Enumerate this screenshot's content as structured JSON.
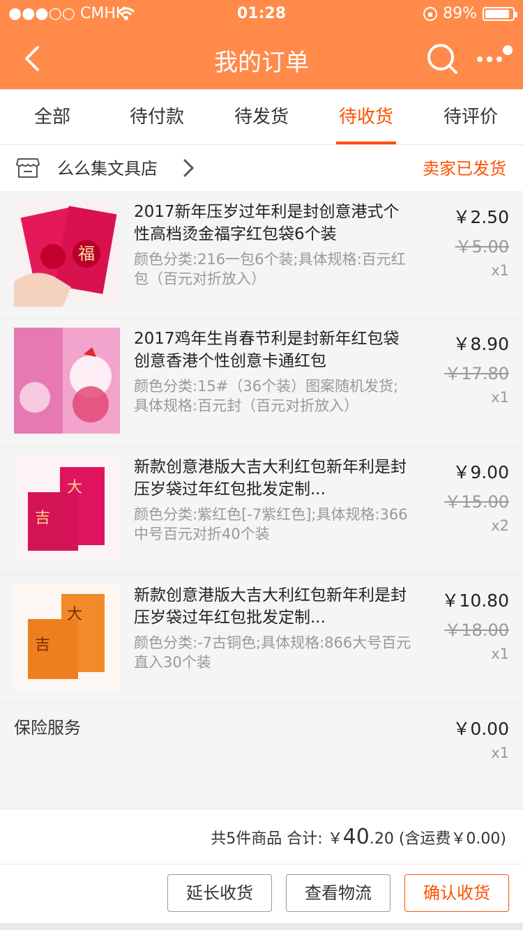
{
  "status_bar": {
    "carrier": "●●●○○ CMHK",
    "time": "01:28",
    "battery": "89%"
  },
  "header": {
    "title": "我的订单"
  },
  "tabs": [
    {
      "label": "全部"
    },
    {
      "label": "待付款"
    },
    {
      "label": "待发货"
    },
    {
      "label": "待收货",
      "active": true
    },
    {
      "label": "待评价"
    }
  ],
  "shop": {
    "name": "么么集文具店",
    "status": "卖家已发货"
  },
  "items": [
    {
      "title": "2017新年压岁过年利是封创意港式个性高档烫金福字红包袋6个装",
      "spec": "颜色分类:216一包6个装;具体规格:百元红包（百元对折放入）",
      "price": "￥2.50",
      "orig_price": "￥5.00",
      "qty": "x1"
    },
    {
      "title": "2017鸡年生肖春节利是封新年红包袋创意香港个性创意卡通红包",
      "spec": "颜色分类:15#（36个装）图案随机发货;具体规格:百元封（百元对折放入）",
      "price": "￥8.90",
      "orig_price": "￥17.80",
      "qty": "x1"
    },
    {
      "title": "新款创意港版大吉大利红包新年利是封压岁袋过年红包批发定制...",
      "spec": "颜色分类:紫红色[-7紫红色];具体规格:366中号百元对折40个装",
      "price": "￥9.00",
      "orig_price": "￥15.00",
      "qty": "x2"
    },
    {
      "title": "新款创意港版大吉大利红包新年利是封压岁袋过年红包批发定制...",
      "spec": "颜色分类:-7古铜色;具体规格:866大号百元直入30个装",
      "price": "￥10.80",
      "orig_price": "￥18.00",
      "qty": "x1"
    }
  ],
  "insurance": {
    "label": "保险服务",
    "price": "￥0.00",
    "qty": "x1"
  },
  "summary": {
    "count_text": "共5件商品 合计:",
    "currency": "￥",
    "total_int": "40",
    "total_dec": ".20",
    "shipping": "(含运费￥0.00)"
  },
  "actions": {
    "extend": "延长收货",
    "logistics": "查看物流",
    "confirm": "确认收货"
  },
  "colors": {
    "header_bg": "#ff8a4a",
    "accent": "#ff5000"
  }
}
